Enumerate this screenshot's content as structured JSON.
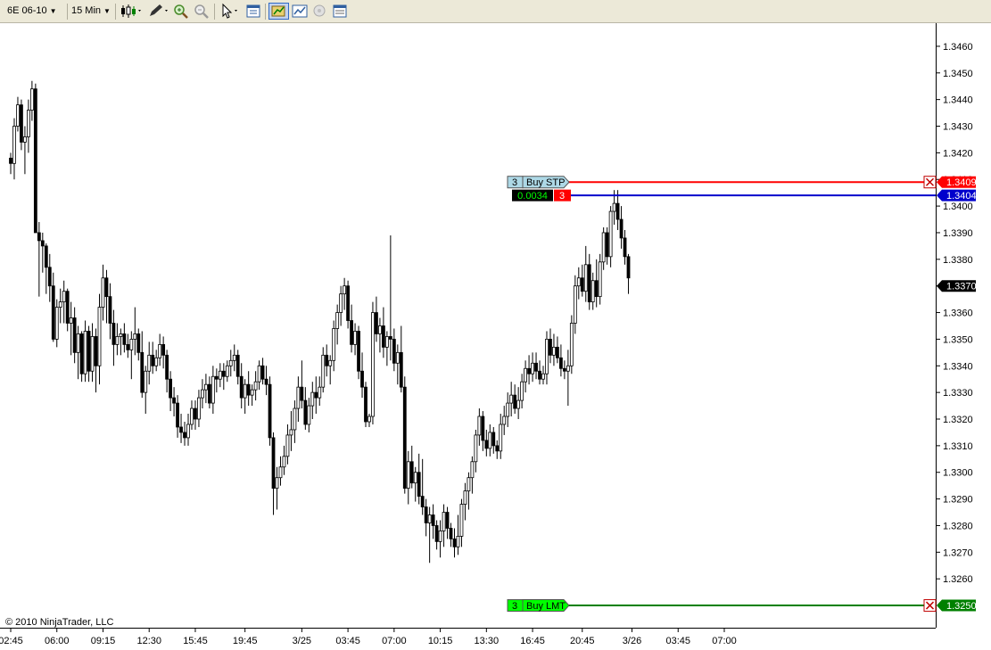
{
  "toolbar": {
    "instrument": "6E 06-10",
    "interval": "15 Min",
    "icons": [
      "chart-style-icon",
      "drawing-tool-icon",
      "zoom-in-icon",
      "zoom-out-icon",
      "cursor-icon",
      "properties-icon",
      "chart-trader-icon",
      "indicators-icon",
      "strategies-icon",
      "data-box-icon"
    ]
  },
  "copyright": "© 2010 NinjaTrader, LLC",
  "orders": [
    {
      "qty": "3",
      "label": "Buy STP",
      "price": "1.3409",
      "color": "#ff0000",
      "tag_bg": "#ff0000"
    },
    {
      "qty": "3",
      "label": "Buy LMT",
      "price": "1.3250",
      "color": "#008000",
      "tag_bg": "#00cc00"
    }
  ],
  "position": {
    "pnl": "0.0034",
    "qty": "3",
    "price": "1.3404",
    "color": "#0000cc"
  },
  "last_price": "1.3370",
  "chart_data": {
    "type": "candlestick",
    "title": "",
    "ylim": [
      1.3246,
      1.3466
    ],
    "y_ticks": [
      "1.3460",
      "1.3450",
      "1.3440",
      "1.3430",
      "1.3420",
      "1.3410",
      "1.3400",
      "1.3390",
      "1.3380",
      "1.3370",
      "1.3360",
      "1.3350",
      "1.3340",
      "1.3330",
      "1.3320",
      "1.3310",
      "1.3300",
      "1.3290",
      "1.3280",
      "1.3270",
      "1.3260"
    ],
    "x_ticks": [
      "02:45",
      "06:00",
      "09:15",
      "12:30",
      "15:45",
      "19:45",
      "3/25",
      "03:45",
      "07:00",
      "10:15",
      "13:30",
      "16:45",
      "20:45",
      "3/26",
      "03:45",
      "07:00"
    ],
    "x_tick_bar_index": [
      0,
      13,
      26,
      39,
      52,
      66,
      82,
      95,
      108,
      121,
      134,
      147,
      161,
      175,
      188,
      201
    ],
    "bars": [
      [
        1.3418,
        1.342,
        1.3412,
        1.3416
      ],
      [
        1.3416,
        1.3433,
        1.341,
        1.343
      ],
      [
        1.343,
        1.3441,
        1.3428,
        1.3438
      ],
      [
        1.3438,
        1.344,
        1.3421,
        1.3424
      ],
      [
        1.3424,
        1.343,
        1.3412,
        1.3426
      ],
      [
        1.3426,
        1.344,
        1.342,
        1.3436
      ],
      [
        1.3436,
        1.3447,
        1.3432,
        1.3444
      ],
      [
        1.3444,
        1.3446,
        1.339,
        1.339
      ],
      [
        1.339,
        1.3394,
        1.3366,
        1.3387
      ],
      [
        1.3387,
        1.339,
        1.3375,
        1.3385
      ],
      [
        1.3385,
        1.3386,
        1.3367,
        1.3377
      ],
      [
        1.3377,
        1.3382,
        1.3364,
        1.337
      ],
      [
        1.337,
        1.3375,
        1.3349,
        1.335
      ],
      [
        1.335,
        1.3365,
        1.3347,
        1.3362
      ],
      [
        1.3362,
        1.3369,
        1.3356,
        1.3364
      ],
      [
        1.3364,
        1.3372,
        1.3356,
        1.3368
      ],
      [
        1.3368,
        1.3369,
        1.3353,
        1.3356
      ],
      [
        1.3356,
        1.3364,
        1.3344,
        1.3358
      ],
      [
        1.3358,
        1.3362,
        1.3341,
        1.3345
      ],
      [
        1.3345,
        1.3355,
        1.3335,
        1.3352
      ],
      [
        1.3352,
        1.3353,
        1.3334,
        1.3337
      ],
      [
        1.3337,
        1.3357,
        1.3334,
        1.3353
      ],
      [
        1.3353,
        1.3355,
        1.3334,
        1.3338
      ],
      [
        1.3338,
        1.3356,
        1.3334,
        1.3351
      ],
      [
        1.3351,
        1.3354,
        1.333,
        1.334
      ],
      [
        1.334,
        1.3367,
        1.3333,
        1.3362
      ],
      [
        1.3362,
        1.3378,
        1.3357,
        1.3373
      ],
      [
        1.3373,
        1.3376,
        1.3356,
        1.3366
      ],
      [
        1.3366,
        1.3371,
        1.335,
        1.3356
      ],
      [
        1.3356,
        1.3361,
        1.334,
        1.3348
      ],
      [
        1.3348,
        1.3356,
        1.3344,
        1.3351
      ],
      [
        1.3351,
        1.3354,
        1.3344,
        1.3352
      ],
      [
        1.3352,
        1.3356,
        1.3345,
        1.3348
      ],
      [
        1.3348,
        1.3352,
        1.3343,
        1.3346
      ],
      [
        1.3346,
        1.3353,
        1.3335,
        1.335
      ],
      [
        1.335,
        1.3362,
        1.3344,
        1.3352
      ],
      [
        1.3352,
        1.3354,
        1.3342,
        1.3345
      ],
      [
        1.3345,
        1.3353,
        1.3328,
        1.333
      ],
      [
        1.333,
        1.334,
        1.3322,
        1.3338
      ],
      [
        1.3338,
        1.3349,
        1.3333,
        1.3344
      ],
      [
        1.3344,
        1.3349,
        1.3337,
        1.334
      ],
      [
        1.334,
        1.3346,
        1.3338,
        1.3343
      ],
      [
        1.3343,
        1.3352,
        1.334,
        1.3348
      ],
      [
        1.3348,
        1.3351,
        1.3339,
        1.3344
      ],
      [
        1.3344,
        1.3346,
        1.333,
        1.3335
      ],
      [
        1.3335,
        1.3338,
        1.3323,
        1.3328
      ],
      [
        1.3328,
        1.3332,
        1.3321,
        1.3326
      ],
      [
        1.3326,
        1.3329,
        1.3313,
        1.3317
      ],
      [
        1.3317,
        1.3322,
        1.3311,
        1.3315
      ],
      [
        1.3315,
        1.3319,
        1.331,
        1.3313
      ],
      [
        1.3313,
        1.3322,
        1.331,
        1.3318
      ],
      [
        1.3318,
        1.3327,
        1.3316,
        1.3324
      ],
      [
        1.3324,
        1.3327,
        1.3316,
        1.332
      ],
      [
        1.332,
        1.3331,
        1.3317,
        1.3328
      ],
      [
        1.3328,
        1.3335,
        1.3324,
        1.3331
      ],
      [
        1.3331,
        1.3337,
        1.3326,
        1.3333
      ],
      [
        1.3333,
        1.3336,
        1.3324,
        1.3326
      ],
      [
        1.3326,
        1.334,
        1.3322,
        1.3336
      ],
      [
        1.3336,
        1.3339,
        1.333,
        1.3335
      ],
      [
        1.3335,
        1.3341,
        1.3332,
        1.3338
      ],
      [
        1.3338,
        1.3341,
        1.3331,
        1.3336
      ],
      [
        1.3336,
        1.3342,
        1.3334,
        1.334
      ],
      [
        1.334,
        1.3346,
        1.3336,
        1.3342
      ],
      [
        1.3342,
        1.3348,
        1.3338,
        1.3344
      ],
      [
        1.3344,
        1.3346,
        1.3333,
        1.3336
      ],
      [
        1.3336,
        1.3341,
        1.3324,
        1.3328
      ],
      [
        1.3328,
        1.3335,
        1.3322,
        1.3333
      ],
      [
        1.3333,
        1.3338,
        1.3325,
        1.3329
      ],
      [
        1.3329,
        1.3333,
        1.3325,
        1.3331
      ],
      [
        1.3331,
        1.3338,
        1.3327,
        1.3334
      ],
      [
        1.3334,
        1.3342,
        1.3331,
        1.334
      ],
      [
        1.334,
        1.3343,
        1.3333,
        1.3335
      ],
      [
        1.3335,
        1.334,
        1.3329,
        1.3333
      ],
      [
        1.3333,
        1.3336,
        1.331,
        1.3313
      ],
      [
        1.3313,
        1.3315,
        1.3284,
        1.3294
      ],
      [
        1.3294,
        1.3302,
        1.3286,
        1.3298
      ],
      [
        1.3298,
        1.3306,
        1.3295,
        1.3302
      ],
      [
        1.3302,
        1.331,
        1.3299,
        1.3306
      ],
      [
        1.3306,
        1.3318,
        1.3303,
        1.3314
      ],
      [
        1.3314,
        1.3323,
        1.3308,
        1.3316
      ],
      [
        1.3316,
        1.3327,
        1.3311,
        1.3324
      ],
      [
        1.3324,
        1.3336,
        1.3319,
        1.3332
      ],
      [
        1.3332,
        1.3342,
        1.3324,
        1.3327
      ],
      [
        1.3327,
        1.3332,
        1.3316,
        1.3318
      ],
      [
        1.3318,
        1.3328,
        1.3315,
        1.3325
      ],
      [
        1.3325,
        1.3334,
        1.332,
        1.333
      ],
      [
        1.333,
        1.3336,
        1.3322,
        1.3328
      ],
      [
        1.3328,
        1.3336,
        1.3325,
        1.3332
      ],
      [
        1.3332,
        1.3347,
        1.333,
        1.3344
      ],
      [
        1.3344,
        1.3348,
        1.3336,
        1.334
      ],
      [
        1.334,
        1.3344,
        1.3333,
        1.3342
      ],
      [
        1.3342,
        1.3357,
        1.3338,
        1.3354
      ],
      [
        1.3354,
        1.3363,
        1.3348,
        1.336
      ],
      [
        1.336,
        1.337,
        1.3355,
        1.3367
      ],
      [
        1.3367,
        1.3373,
        1.3361,
        1.337
      ],
      [
        1.337,
        1.3372,
        1.3354,
        1.3357
      ],
      [
        1.3357,
        1.3363,
        1.3345,
        1.3348
      ],
      [
        1.3348,
        1.3356,
        1.3344,
        1.3353
      ],
      [
        1.3353,
        1.3355,
        1.3335,
        1.3338
      ],
      [
        1.3338,
        1.3345,
        1.3328,
        1.3332
      ],
      [
        1.3332,
        1.3334,
        1.3317,
        1.3319
      ],
      [
        1.3319,
        1.3322,
        1.3317,
        1.3321
      ],
      [
        1.3321,
        1.3364,
        1.3318,
        1.336
      ],
      [
        1.336,
        1.3366,
        1.3349,
        1.3352
      ],
      [
        1.3352,
        1.3358,
        1.3345,
        1.3355
      ],
      [
        1.3355,
        1.3362,
        1.3343,
        1.3347
      ],
      [
        1.3347,
        1.3353,
        1.334,
        1.3351
      ],
      [
        1.3351,
        1.3389,
        1.3342,
        1.335
      ],
      [
        1.335,
        1.3354,
        1.3338,
        1.3341
      ],
      [
        1.3341,
        1.3348,
        1.3333,
        1.3345
      ],
      [
        1.3345,
        1.3355,
        1.333,
        1.3332
      ],
      [
        1.3332,
        1.3336,
        1.3292,
        1.3294
      ],
      [
        1.3294,
        1.3308,
        1.3288,
        1.3304
      ],
      [
        1.3304,
        1.331,
        1.3294,
        1.3296
      ],
      [
        1.3296,
        1.3302,
        1.3289,
        1.33
      ],
      [
        1.33,
        1.3307,
        1.3288,
        1.3291
      ],
      [
        1.3291,
        1.3305,
        1.3284,
        1.3287
      ],
      [
        1.3287,
        1.329,
        1.3276,
        1.3281
      ],
      [
        1.3281,
        1.3287,
        1.3266,
        1.3284
      ],
      [
        1.3284,
        1.3288,
        1.3275,
        1.328
      ],
      [
        1.328,
        1.3282,
        1.3271,
        1.3274
      ],
      [
        1.3274,
        1.3282,
        1.3268,
        1.3278
      ],
      [
        1.3278,
        1.3288,
        1.3272,
        1.3285
      ],
      [
        1.3285,
        1.3287,
        1.3275,
        1.3279
      ],
      [
        1.3279,
        1.3281,
        1.3272,
        1.3275
      ],
      [
        1.3275,
        1.3279,
        1.3268,
        1.3272
      ],
      [
        1.3272,
        1.3284,
        1.3269,
        1.3276
      ],
      [
        1.3276,
        1.329,
        1.3272,
        1.3288
      ],
      [
        1.3288,
        1.3296,
        1.3282,
        1.3293
      ],
      [
        1.3293,
        1.33,
        1.3286,
        1.3298
      ],
      [
        1.3298,
        1.3306,
        1.3292,
        1.3304
      ],
      [
        1.3304,
        1.3316,
        1.33,
        1.3314
      ],
      [
        1.3314,
        1.3324,
        1.331,
        1.3321
      ],
      [
        1.3321,
        1.3323,
        1.3308,
        1.3312
      ],
      [
        1.3312,
        1.3316,
        1.3306,
        1.3309
      ],
      [
        1.3309,
        1.3318,
        1.3306,
        1.3315
      ],
      [
        1.3315,
        1.3317,
        1.3307,
        1.331
      ],
      [
        1.331,
        1.3312,
        1.3305,
        1.3308
      ],
      [
        1.3308,
        1.3322,
        1.3305,
        1.3318
      ],
      [
        1.3318,
        1.3325,
        1.3314,
        1.3321
      ],
      [
        1.3321,
        1.333,
        1.3317,
        1.3326
      ],
      [
        1.3326,
        1.3334,
        1.3321,
        1.3329
      ],
      [
        1.3329,
        1.3333,
        1.3322,
        1.3324
      ],
      [
        1.3324,
        1.3332,
        1.332,
        1.3327
      ],
      [
        1.3327,
        1.3337,
        1.3324,
        1.3334
      ],
      [
        1.3334,
        1.3342,
        1.333,
        1.3339
      ],
      [
        1.3339,
        1.3344,
        1.3333,
        1.3337
      ],
      [
        1.3337,
        1.3345,
        1.3334,
        1.3341
      ],
      [
        1.3341,
        1.3345,
        1.3335,
        1.3338
      ],
      [
        1.3338,
        1.3342,
        1.3333,
        1.3335
      ],
      [
        1.3335,
        1.334,
        1.3333,
        1.3337
      ],
      [
        1.3337,
        1.3353,
        1.3333,
        1.335
      ],
      [
        1.335,
        1.3354,
        1.3341,
        1.3344
      ],
      [
        1.3344,
        1.3352,
        1.334,
        1.3347
      ],
      [
        1.3347,
        1.3351,
        1.3341,
        1.3343
      ],
      [
        1.3343,
        1.3348,
        1.3336,
        1.3339
      ],
      [
        1.3339,
        1.3342,
        1.3335,
        1.3338
      ],
      [
        1.3338,
        1.3346,
        1.3325,
        1.334
      ],
      [
        1.334,
        1.3359,
        1.3337,
        1.3356
      ],
      [
        1.3356,
        1.3374,
        1.3352,
        1.337
      ],
      [
        1.337,
        1.3377,
        1.3365,
        1.3373
      ],
      [
        1.3373,
        1.3378,
        1.3366,
        1.3368
      ],
      [
        1.3368,
        1.3385,
        1.3364,
        1.3378
      ],
      [
        1.3378,
        1.3382,
        1.3361,
        1.3364
      ],
      [
        1.3364,
        1.3375,
        1.3361,
        1.3372
      ],
      [
        1.3372,
        1.338,
        1.3362,
        1.3366
      ],
      [
        1.3366,
        1.3382,
        1.3363,
        1.3379
      ],
      [
        1.3379,
        1.3392,
        1.3376,
        1.339
      ],
      [
        1.339,
        1.3392,
        1.3378,
        1.3381
      ],
      [
        1.3381,
        1.34,
        1.3377,
        1.3398
      ],
      [
        1.3398,
        1.3406,
        1.3393,
        1.3401
      ],
      [
        1.3401,
        1.3406,
        1.3391,
        1.3395
      ],
      [
        1.3395,
        1.34,
        1.3384,
        1.3388
      ],
      [
        1.3388,
        1.3391,
        1.3378,
        1.3381
      ],
      [
        1.3381,
        1.3382,
        1.3367,
        1.3373
      ]
    ]
  }
}
